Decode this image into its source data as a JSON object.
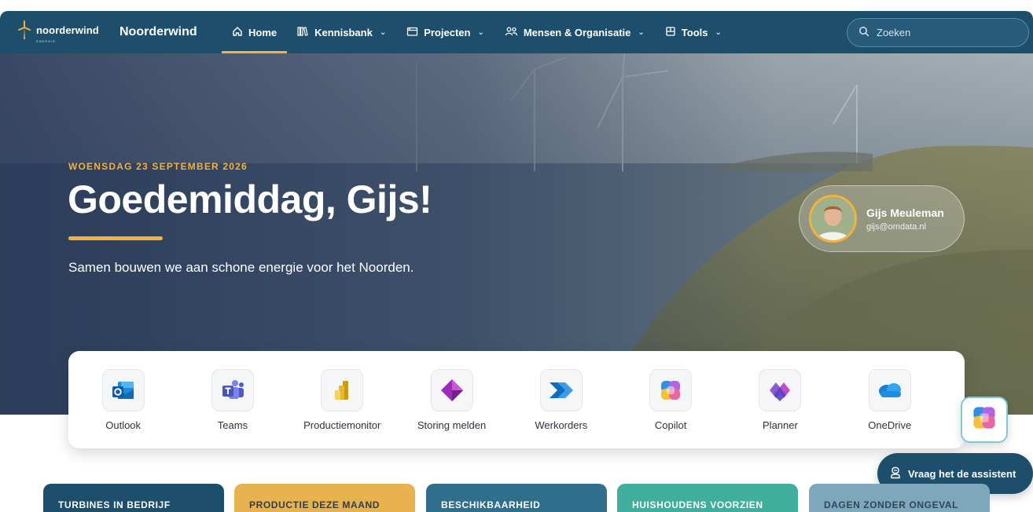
{
  "header": {
    "logo_text": "noorderwind",
    "logo_tagline": "ENERGIE",
    "brand": "Noorderwind",
    "nav": [
      {
        "label": "Home",
        "icon": "home-icon",
        "active": true,
        "dropdown": false
      },
      {
        "label": "Kennisbank",
        "icon": "library-icon",
        "active": false,
        "dropdown": true
      },
      {
        "label": "Projecten",
        "icon": "folder-icon",
        "active": false,
        "dropdown": true
      },
      {
        "label": "Mensen & Organisatie",
        "icon": "people-icon",
        "active": false,
        "dropdown": true
      },
      {
        "label": "Tools",
        "icon": "tools-icon",
        "active": false,
        "dropdown": true
      }
    ],
    "search_placeholder": "Zoeken"
  },
  "hero": {
    "date": "WOENSDAG 23 SEPTEMBER 2026",
    "greeting": "Goedemiddag, Gijs!",
    "subtitle": "Samen bouwen we aan schone energie voor het Noorden."
  },
  "profile": {
    "name": "Gijs Meuleman",
    "email": "gijs@omdata.nl"
  },
  "apps": [
    {
      "label": "Outlook",
      "icon": "outlook-icon"
    },
    {
      "label": "Teams",
      "icon": "teams-icon"
    },
    {
      "label": "Productiemonitor",
      "icon": "power-bi-icon"
    },
    {
      "label": "Storing melden",
      "icon": "power-apps-icon"
    },
    {
      "label": "Werkorders",
      "icon": "power-automate-icon"
    },
    {
      "label": "Copilot",
      "icon": "copilot-icon"
    },
    {
      "label": "Planner",
      "icon": "planner-icon"
    },
    {
      "label": "OneDrive",
      "icon": "onedrive-icon"
    }
  ],
  "assistant": {
    "label": "Vraag het de assistent"
  },
  "stats": [
    {
      "label": "TURBINES IN BEDRIJF"
    },
    {
      "label": "PRODUCTIE DEZE MAAND"
    },
    {
      "label": "BESCHIKBAARHEID"
    },
    {
      "label": "HUISHOUDENS VOORZIEN"
    },
    {
      "label": "DAGEN ZONDER ONGEVAL"
    }
  ],
  "colors": {
    "primary": "#1d4e6b",
    "accent": "#f2b33d"
  }
}
